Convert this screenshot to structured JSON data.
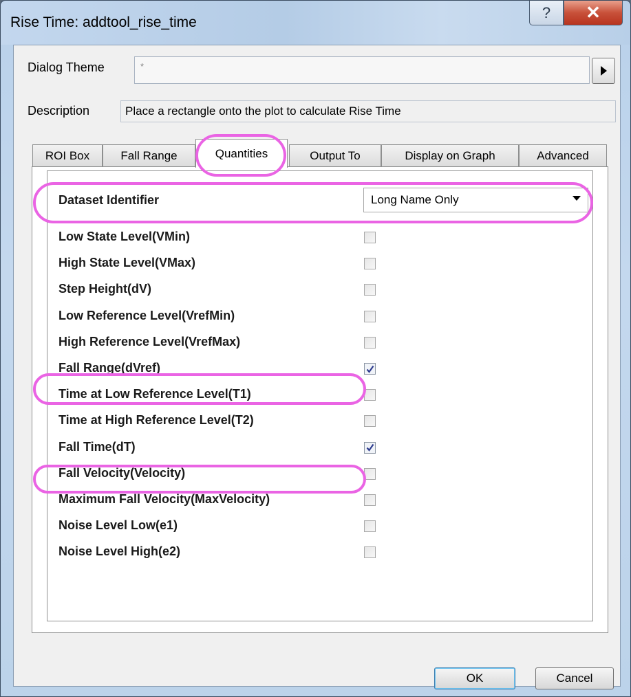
{
  "window": {
    "title": "Rise Time: addtool_rise_time"
  },
  "titlebar": {
    "help_label": "?",
    "close_label": "✕"
  },
  "theme": {
    "label": "Dialog Theme",
    "value": "*"
  },
  "description": {
    "label": "Description",
    "text": "Place a rectangle onto the plot to calculate Rise Time"
  },
  "tabs": [
    {
      "label": "ROI Box",
      "active": false
    },
    {
      "label": "Fall Range",
      "active": false
    },
    {
      "label": "Quantities",
      "active": true
    },
    {
      "label": "Output To",
      "active": false
    },
    {
      "label": "Display on Graph",
      "active": false
    },
    {
      "label": "Advanced",
      "active": false
    }
  ],
  "quantities": {
    "dataset_identifier": {
      "label": "Dataset Identifier",
      "value": "Long Name Only"
    },
    "rows": [
      {
        "label": "Low State Level(VMin)",
        "checked": false
      },
      {
        "label": "High State Level(VMax)",
        "checked": false
      },
      {
        "label": "Step Height(dV)",
        "checked": false
      },
      {
        "label": "Low Reference Level(VrefMin)",
        "checked": false
      },
      {
        "label": "High Reference Level(VrefMax)",
        "checked": false
      },
      {
        "label": "Fall Range(dVref)",
        "checked": true
      },
      {
        "label": "Time at Low Reference Level(T1)",
        "checked": false
      },
      {
        "label": "Time at High Reference Level(T2)",
        "checked": false
      },
      {
        "label": "Fall Time(dT)",
        "checked": true
      },
      {
        "label": "Fall Velocity(Velocity)",
        "checked": false
      },
      {
        "label": "Maximum Fall Velocity(MaxVelocity)",
        "checked": false
      },
      {
        "label": "Noise Level Low(e1)",
        "checked": false
      },
      {
        "label": "Noise Level High(e2)",
        "checked": false
      }
    ]
  },
  "buttons": {
    "ok": "OK",
    "cancel": "Cancel"
  },
  "colors": {
    "highlight": "#ea64e4",
    "check": "#2e3d8f",
    "close_button": "#c8513a"
  }
}
